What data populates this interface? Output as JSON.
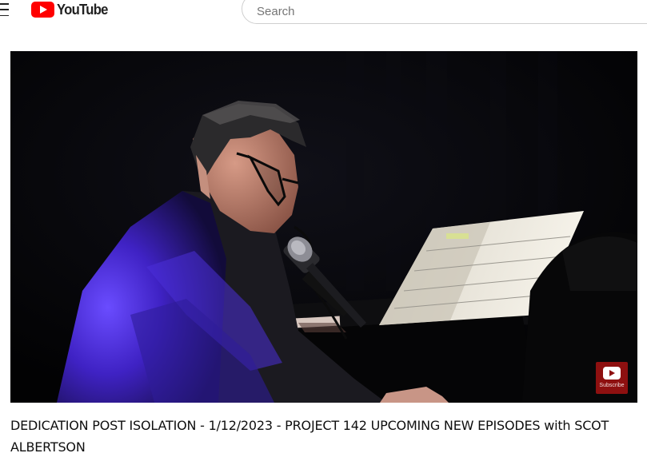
{
  "header": {
    "logo_text": "YouTube",
    "search_placeholder": "Search"
  },
  "player": {
    "watermark_label": "Subscribe"
  },
  "video": {
    "title": "DEDICATION POST ISOLATION - 1/12/2023 - PROJECT 142 UPCOMING NEW EPISODES with SCOT ALBERTSON"
  },
  "colors": {
    "brand_red": "#ff0000",
    "watermark_red": "#8e1010",
    "stage_light": "#3a24c8"
  },
  "icons": [
    "menu-icon",
    "youtube-logo-icon",
    "subscribe-watermark-icon"
  ]
}
